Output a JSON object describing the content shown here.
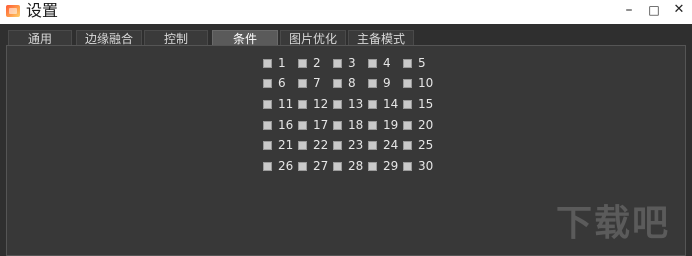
{
  "window": {
    "title": "设置",
    "min_label": "–",
    "max_label": "□",
    "close_label": "✕"
  },
  "tabs": [
    {
      "label": "通用",
      "active": false
    },
    {
      "label": "边缘融合",
      "active": false
    },
    {
      "label": "控制",
      "active": false
    },
    {
      "label": "条件",
      "active": true
    },
    {
      "label": "图片优化",
      "active": false
    },
    {
      "label": "主备模式",
      "active": false
    }
  ],
  "conditions": [
    {
      "label": "1",
      "checked": false
    },
    {
      "label": "2",
      "checked": false
    },
    {
      "label": "3",
      "checked": false
    },
    {
      "label": "4",
      "checked": false
    },
    {
      "label": "5",
      "checked": false
    },
    {
      "label": "6",
      "checked": false
    },
    {
      "label": "7",
      "checked": false
    },
    {
      "label": "8",
      "checked": false
    },
    {
      "label": "9",
      "checked": false
    },
    {
      "label": "10",
      "checked": false
    },
    {
      "label": "11",
      "checked": false
    },
    {
      "label": "12",
      "checked": false
    },
    {
      "label": "13",
      "checked": false
    },
    {
      "label": "14",
      "checked": false
    },
    {
      "label": "15",
      "checked": false
    },
    {
      "label": "16",
      "checked": false
    },
    {
      "label": "17",
      "checked": false
    },
    {
      "label": "18",
      "checked": false
    },
    {
      "label": "19",
      "checked": false
    },
    {
      "label": "20",
      "checked": false
    },
    {
      "label": "21",
      "checked": false
    },
    {
      "label": "22",
      "checked": false
    },
    {
      "label": "23",
      "checked": false
    },
    {
      "label": "24",
      "checked": false
    },
    {
      "label": "25",
      "checked": false
    },
    {
      "label": "26",
      "checked": false
    },
    {
      "label": "27",
      "checked": false
    },
    {
      "label": "28",
      "checked": false
    },
    {
      "label": "29",
      "checked": false
    },
    {
      "label": "30",
      "checked": false
    }
  ],
  "watermark": "下载吧",
  "colors": {
    "window_bg": "#2f2f2f",
    "panel_bg": "#383838",
    "active_tab": "#5a5a5a",
    "checkbox": "#c9c9c9"
  }
}
